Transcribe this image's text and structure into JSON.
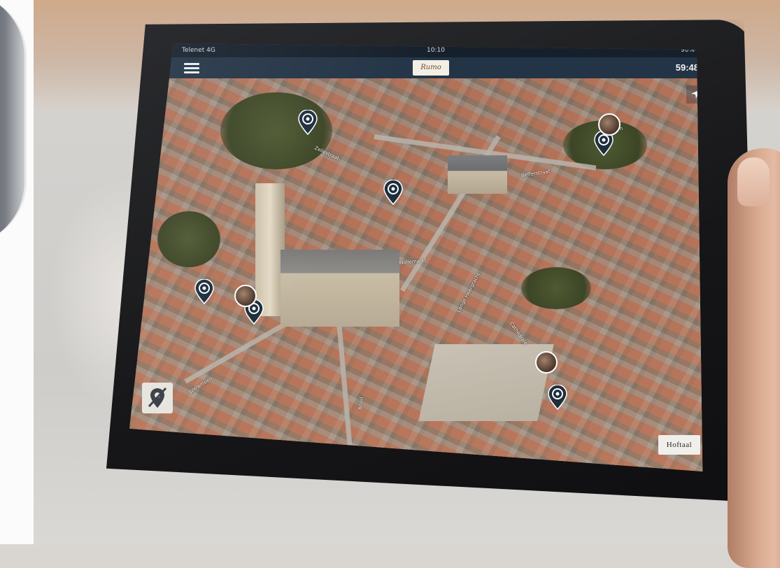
{
  "status_bar": {
    "carrier": "Telenet 4G",
    "time": "10:10",
    "battery": "90%"
  },
  "nav_bar": {
    "logo_text": "Rumo",
    "timer": "59:48"
  },
  "map": {
    "back_button_label": "Hoftaal",
    "street_labels": [
      "Melaan",
      "Zeilestraat",
      "Befferstraat",
      "Wollemarkt",
      "Lange Heergracht",
      "Bruul",
      "IJzerenleen",
      "Cathedrale"
    ]
  },
  "colors": {
    "nav_bar": "#233446",
    "status_bar": "#16202c",
    "marker": "#1e2e3d"
  },
  "icons": {
    "menu": "hamburger-menu-icon",
    "location": "navigation-arrow-icon",
    "marker": "poi-target-marker-icon",
    "poi_toggle": "hide-poi-marker-icon"
  }
}
